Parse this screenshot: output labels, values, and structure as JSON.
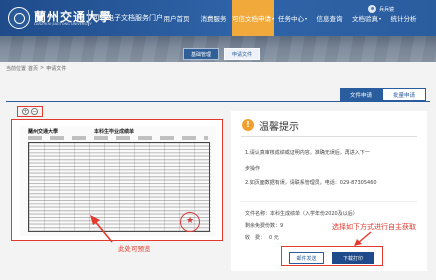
{
  "header": {
    "logo_name": "蘭州交通大學",
    "logo_en": "LANZHOU JIAOTONG UNIVERSITY",
    "portal_title": "可信电子文档服务门户",
    "nav": [
      {
        "label": "用户首页",
        "caret": ""
      },
      {
        "label": "消费服务",
        "caret": ""
      },
      {
        "label": "可信文档申请",
        "caret": "▾"
      },
      {
        "label": "任务中心",
        "caret": "▾"
      },
      {
        "label": "信息查询",
        "caret": ""
      },
      {
        "label": "文档验真",
        "caret": "▾"
      },
      {
        "label": "统计分析",
        "caret": ""
      }
    ],
    "user_name": "兵兵镜"
  },
  "subtabs": [
    "基础管理",
    "申请文件"
  ],
  "breadcrumb": {
    "prefix": "当前位置",
    "home": "首页",
    "sep": ">",
    "current": "申请文件"
  },
  "apply_tabs": {
    "single": "文件申请",
    "batch": "批量申请"
  },
  "preview": {
    "doc_header": "蘭州交通大學",
    "doc_title": "本科生毕业成绩单",
    "note": "此处可预览",
    "zoom_in": "+",
    "zoom_out": "−"
  },
  "tips": {
    "icon": "!",
    "title": "温馨提示",
    "lines": [
      "1.请认真审核成绩或证明内容。准确无误后，再进入下一",
      "步操作",
      "2.如页面数据有误，请联系管理员。电话：029-87305460"
    ],
    "file_label": "文件名称：",
    "file_value": "本科生成绩单（入学年份2020及以后）",
    "remaining_label": "剩余免费份数：",
    "remaining_value": "9",
    "fee_label": "收　费：",
    "fee_value": "0 元",
    "highlight_note": "选择如下方式进行自主获取",
    "mail_button": "邮件发送",
    "download_button": "下载打印"
  },
  "colors": {
    "brand": "#2a5d9e",
    "accent": "#f2a93b",
    "annotation": "#e23a2e"
  }
}
